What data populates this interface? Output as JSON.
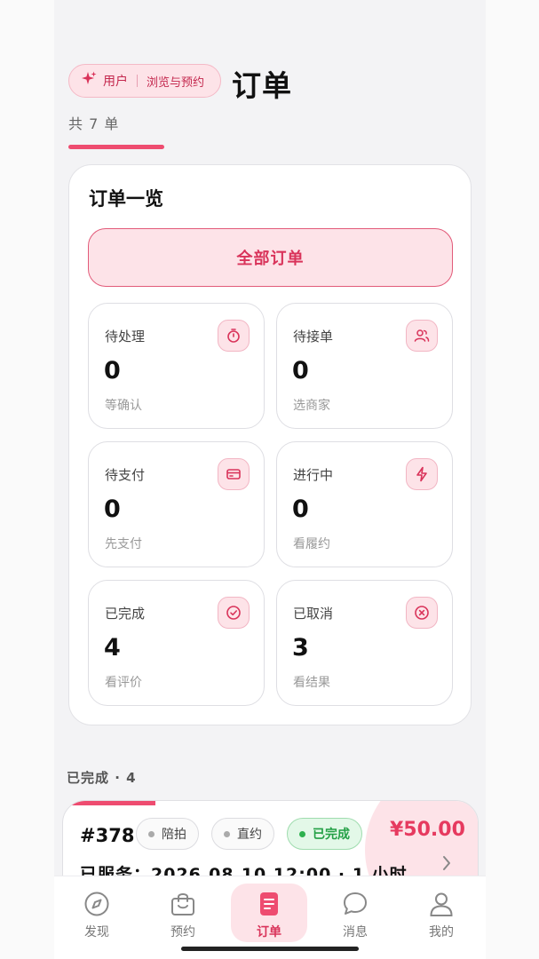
{
  "header": {
    "role_label": "用户",
    "mode_label": "浏览与预约",
    "title": "订单",
    "order_count_text": "共 7 单"
  },
  "overview": {
    "title": "订单一览",
    "all_orders_label": "全部订单",
    "stats": [
      {
        "label": "待处理",
        "value": "0",
        "sub": "等确认",
        "icon": "timer-icon"
      },
      {
        "label": "待接单",
        "value": "0",
        "sub": "选商家",
        "icon": "users-icon"
      },
      {
        "label": "待支付",
        "value": "0",
        "sub": "先支付",
        "icon": "credit-card-icon"
      },
      {
        "label": "进行中",
        "value": "0",
        "sub": "看履约",
        "icon": "lightning-icon"
      },
      {
        "label": "已完成",
        "value": "4",
        "sub": "看评价",
        "icon": "check-circle-icon"
      },
      {
        "label": "已取消",
        "value": "3",
        "sub": "看结果",
        "icon": "x-circle-icon"
      }
    ]
  },
  "section": {
    "title": "已完成 · 4"
  },
  "order": {
    "id": "#378",
    "chips": [
      "陪拍",
      "直约",
      "已完成"
    ],
    "price": "¥50.00",
    "served_text": "已服务：2026.08.10 12:00 · 1 小时"
  },
  "tabbar": {
    "items": [
      {
        "label": "发现",
        "icon": "compass-icon"
      },
      {
        "label": "预约",
        "icon": "shopping-bag-icon"
      },
      {
        "label": "订单",
        "icon": "document-icon"
      },
      {
        "label": "消息",
        "icon": "chat-bubble-icon"
      },
      {
        "label": "我的",
        "icon": "user-icon"
      }
    ],
    "active_index": 2
  },
  "colors": {
    "accent": "#ee4c70",
    "accent_light": "#fde3e8",
    "success": "#2db14e",
    "background": "#f3f3f5"
  }
}
